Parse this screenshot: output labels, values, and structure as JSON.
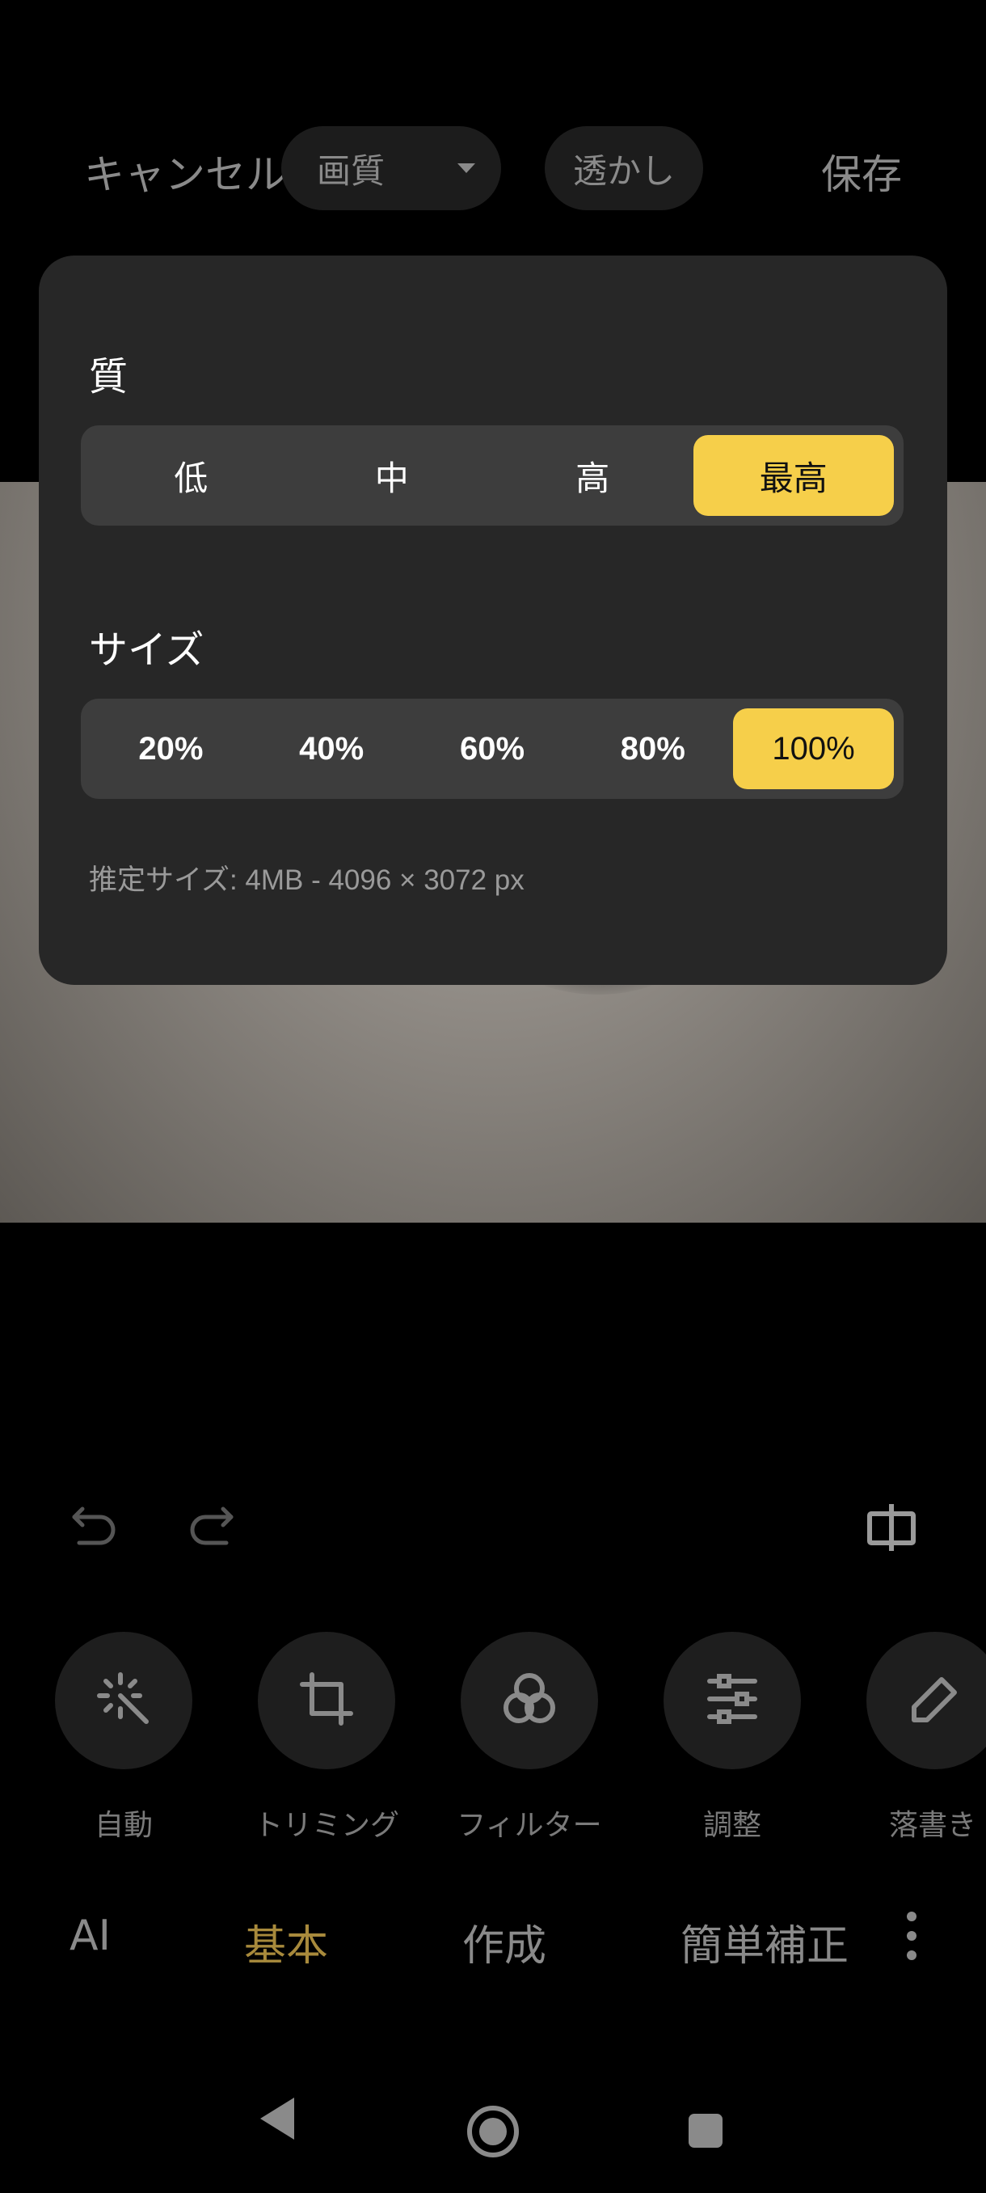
{
  "topbar": {
    "cancel_label": "キャンセル",
    "quality_dropdown_label": "画質",
    "watermark_label": "透かし",
    "save_label": "保存"
  },
  "popup": {
    "quality_title": "質",
    "quality_options": [
      "低",
      "中",
      "高",
      "最高"
    ],
    "quality_selected": "最高",
    "size_title": "サイズ",
    "size_options": [
      "20%",
      "40%",
      "60%",
      "80%",
      "100%"
    ],
    "size_selected": "100%",
    "estimate_text": "推定サイズ: 4MB - 4096 × 3072 px",
    "accent_color": "#f6cf4a"
  },
  "edit_controls": {
    "undo_icon": "undo-icon",
    "redo_icon": "redo-icon",
    "compare_icon": "compare-icon"
  },
  "tools": [
    {
      "label": "自動",
      "icon": "magic-wand-icon"
    },
    {
      "label": "トリミング",
      "icon": "crop-icon"
    },
    {
      "label": "フィルター",
      "icon": "filter-icon"
    },
    {
      "label": "調整",
      "icon": "sliders-icon"
    },
    {
      "label": "落書き",
      "icon": "pen-icon"
    }
  ],
  "categories": {
    "items": [
      "AI",
      "基本",
      "作成",
      "簡単補正"
    ],
    "active": "基本",
    "active_color": "#a88a3c"
  },
  "navbar": {
    "back_icon": "back-triangle-icon",
    "home_icon": "home-circle-icon",
    "recents_icon": "recents-square-icon"
  }
}
